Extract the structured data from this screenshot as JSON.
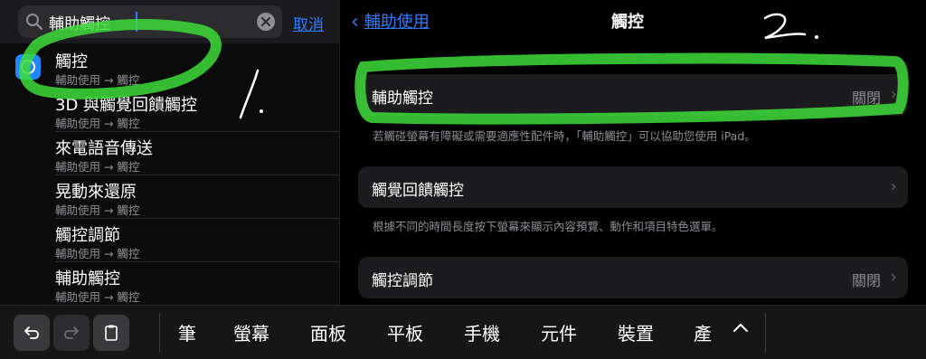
{
  "search": {
    "query": "輔助觸控",
    "cancel_label": "取消"
  },
  "results": [
    {
      "title": "觸控",
      "path": "輔助使用 → 觸控"
    },
    {
      "title": "3D 與觸覺回饋觸控",
      "path": "輔助使用 → 觸控"
    },
    {
      "title": "來電語音傳送",
      "path": "輔助使用 → 觸控"
    },
    {
      "title": "晃動來還原",
      "path": "輔助使用 → 觸控"
    },
    {
      "title": "觸控調節",
      "path": "輔助使用 → 觸控"
    },
    {
      "title": "輔助觸控",
      "path": "輔助使用 → 觸控"
    }
  ],
  "nav": {
    "back_label": "輔助使用",
    "title": "觸控"
  },
  "settings": {
    "assistive_touch": {
      "label": "輔助觸控",
      "value": "關閉"
    },
    "assistive_touch_note": "若觸碰螢幕有障礙或需要適應性配件時，「輔助觸控」可以協助您使用 iPad。",
    "haptic_touch": {
      "label": "觸覺回饋觸控"
    },
    "haptic_touch_note": "根據不同的時間長度按下螢幕來顯示內容預覽、動作和項目特色選單。",
    "touch_accommodations": {
      "label": "觸控調節",
      "value": "關閉"
    }
  },
  "keyboard": {
    "suggestions": [
      "筆",
      "螢幕",
      "面板",
      "平板",
      "手機",
      "元件",
      "裝置",
      "產"
    ]
  },
  "colors": {
    "accent": "#2f7bff",
    "highlighter": "#3ddc3a"
  }
}
